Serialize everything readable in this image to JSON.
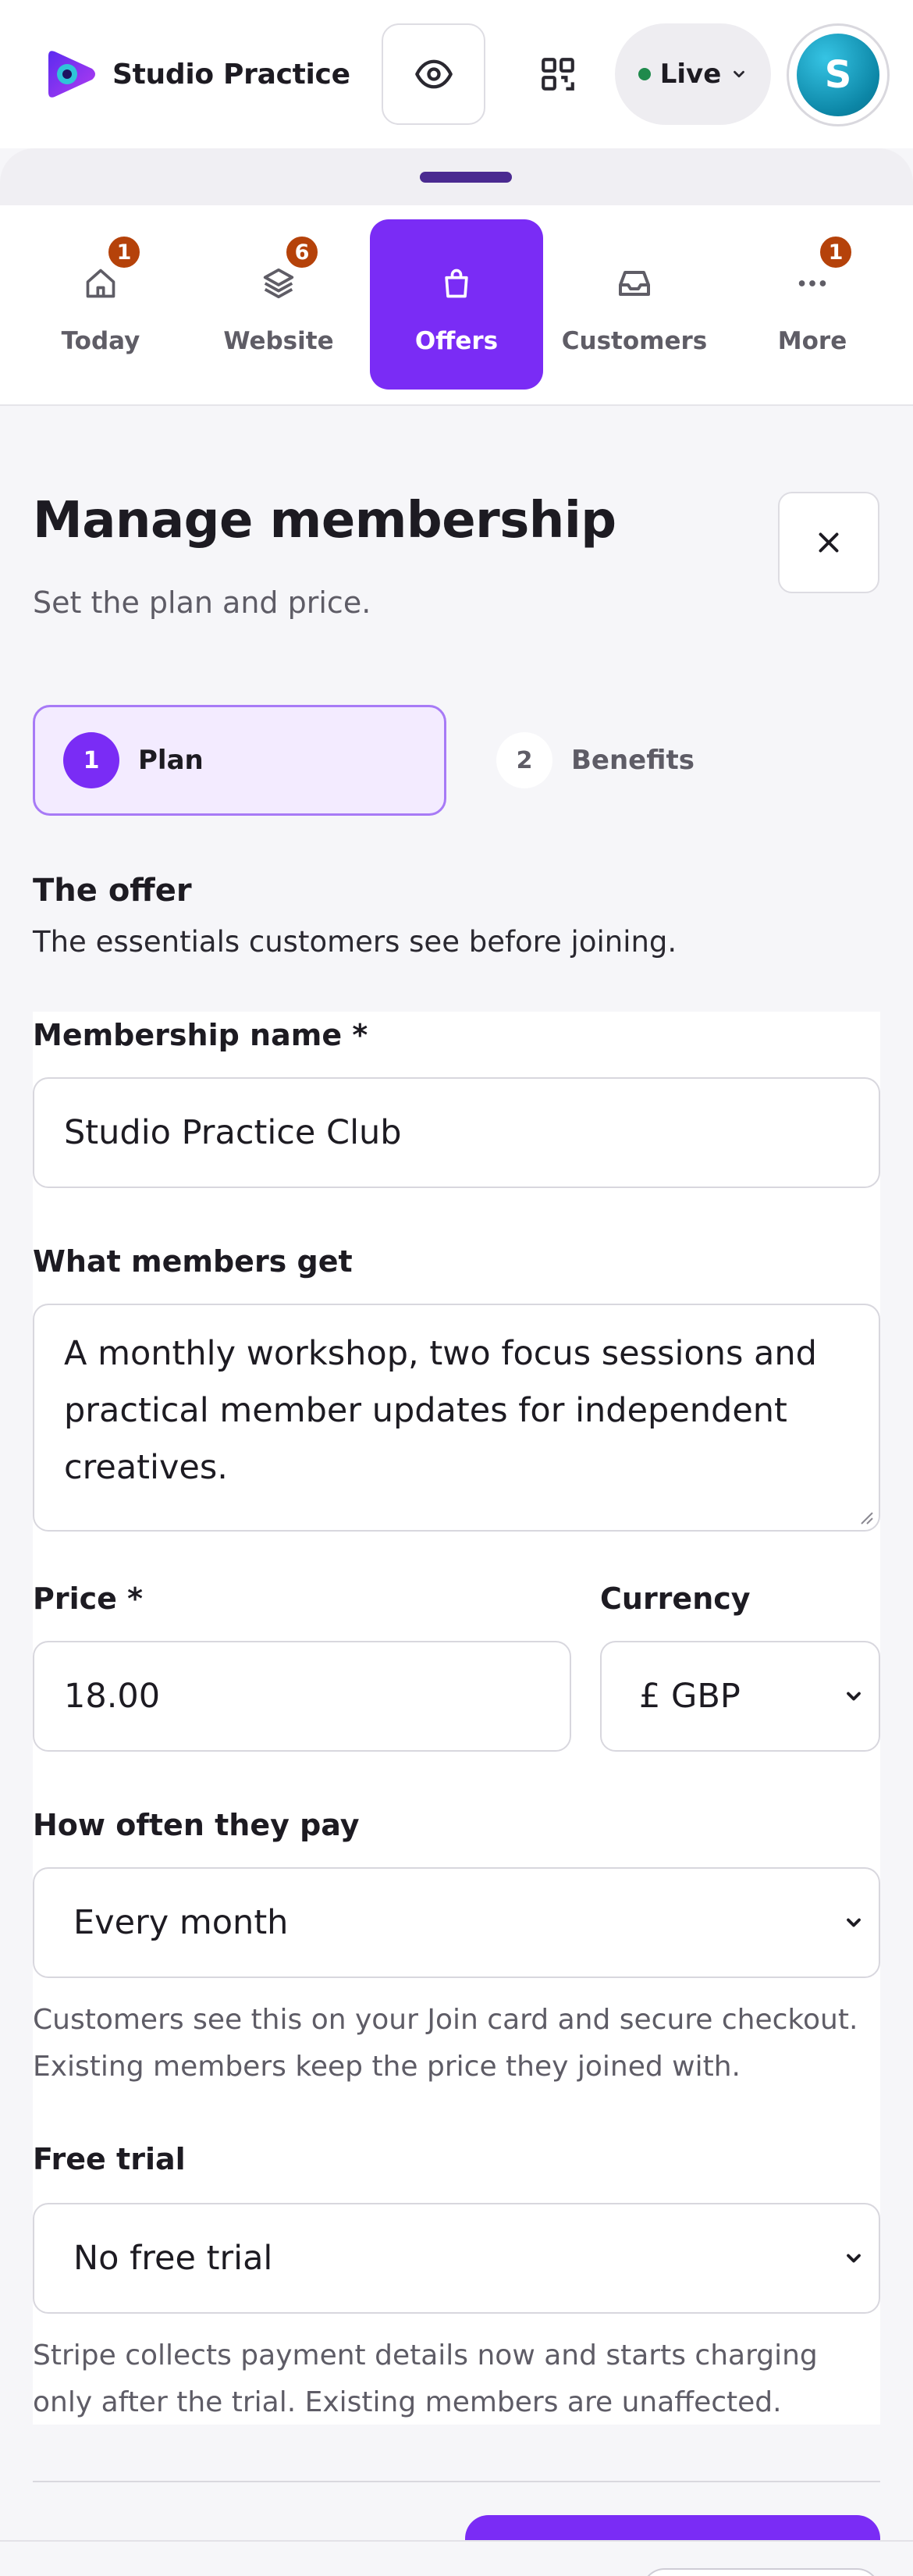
{
  "header": {
    "brand_name": "Studio Practice",
    "live_label": "Live",
    "avatar_initial": "S",
    "icons": [
      "eye-icon",
      "qr-code-icon",
      "chevron-down-icon"
    ],
    "live_color": "#1f8a4c"
  },
  "tabs": [
    {
      "label": "Today",
      "icon": "home-icon",
      "badge": "1",
      "active": false
    },
    {
      "label": "Website",
      "icon": "layers-icon",
      "badge": "6",
      "active": false
    },
    {
      "label": "Offers",
      "icon": "shopping-bag-icon",
      "badge": "",
      "active": true
    },
    {
      "label": "Customers",
      "icon": "inbox-icon",
      "badge": "",
      "active": false
    },
    {
      "label": "More",
      "icon": "more-dots-icon",
      "badge": "1",
      "active": false
    }
  ],
  "page": {
    "title": "Manage membership",
    "subtitle": "Set the plan and price."
  },
  "steps": [
    {
      "number": "1",
      "label": "Plan",
      "active": true
    },
    {
      "number": "2",
      "label": "Benefits",
      "active": false
    }
  ],
  "section": {
    "title": "The offer",
    "subtitle": "The essentials customers see before joining."
  },
  "form": {
    "name_label": "Membership name *",
    "name_value": "Studio Practice Club",
    "benefits_label": "What members get",
    "benefits_value": "A monthly workshop, two focus sessions and practical member updates for independent creatives.",
    "price_label": "Price *",
    "price_value": "18.00",
    "currency_label": "Currency",
    "currency_value": "£ GBP",
    "frequency_label": "How often they pay",
    "frequency_value": "Every month",
    "frequency_help": "Customers see this on your Join card and secure checkout. Existing members keep the price they joined with.",
    "trial_label": "Free trial",
    "trial_value": "No free trial",
    "trial_help": "Stripe collects payment details now and starts charging only after the trial. Existing members are unaffected."
  },
  "colors": {
    "accent": "#7a2cf5",
    "badge": "#b5420a",
    "step_active_bg": "#f3ebff"
  }
}
